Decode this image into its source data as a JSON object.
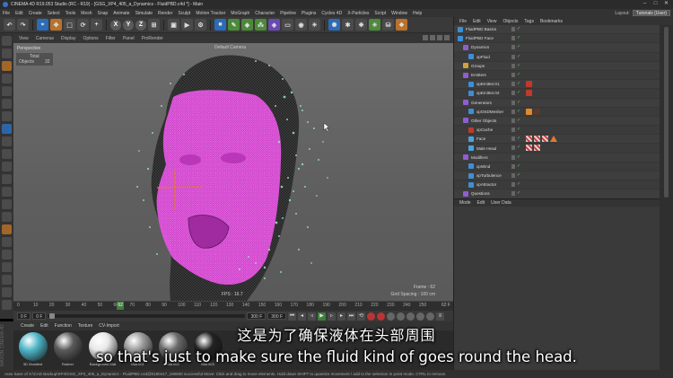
{
  "window": {
    "title": "CINEMA 4D R19.053 Studio (RC - R19) - [GSG_XP4_405_a_Dynamics - FluidPBD.c4d *] - Main"
  },
  "menu": [
    "File",
    "Edit",
    "Create",
    "Select",
    "Tools",
    "Mesh",
    "Snap",
    "Animate",
    "Simulate",
    "Render",
    "Sculpt",
    "Motion Tracker",
    "MoGraph",
    "Character",
    "Pipeline",
    "Plugins",
    "Cycles 4D",
    "X-Particles",
    "Script",
    "Window",
    "Help"
  ],
  "layout": {
    "label": "Layout:",
    "value": "Tutorials (User)"
  },
  "toolbar": {
    "x": "X",
    "y": "Y",
    "z": "Z"
  },
  "viewport": {
    "menu": [
      "View",
      "Cameras",
      "Display",
      "Options",
      "Filter",
      "Panel",
      "ProRender"
    ],
    "view_name": "Perspective",
    "stats_label": "Total",
    "stats_objects_label": "Objects",
    "stats_objects_value": "32",
    "camera": "Default Camera",
    "frame": "Frame : 62",
    "grid_spacing": "Grid Spacing : 100 cm",
    "fps": "FPS : 16.7"
  },
  "timeline": {
    "ticks": [
      "0",
      "10",
      "20",
      "30",
      "40",
      "50",
      "60",
      "70",
      "80",
      "90",
      "100",
      "110",
      "120",
      "130",
      "140",
      "150",
      "160",
      "170",
      "180",
      "190",
      "200",
      "210",
      "220",
      "230",
      "240",
      "250"
    ],
    "current": "62",
    "end": "62 F"
  },
  "transport": {
    "start": "0 F",
    "start2": "0 F",
    "end": "300 F",
    "end2": "300 F"
  },
  "materials": {
    "menu": [
      "Create",
      "Edit",
      "Function",
      "Texture",
      "CV-Import"
    ],
    "items": [
      {
        "name": "3D Gradient",
        "color": "#4fb7c9"
      },
      {
        "name": "Rubber",
        "color": "#5a5a5a"
      },
      {
        "name": "Background Mat",
        "color": "#e8e8e8"
      },
      {
        "name": "Mat.001",
        "color": "#9a9a9a"
      },
      {
        "name": "Mat.002",
        "color": "#6a6a6a"
      },
      {
        "name": "Mat.003",
        "color": "#222222"
      }
    ]
  },
  "side_label": "MAXON CINEMA 4D",
  "status": "Auto Save of X:\\CAD Backup\\XP4\\GSG_XP4_405_a_Dynamics - FluidPBD.c4d@0180417_190600 successful   Move: Click and drag to move elements. Hold down SHIFT to quantize movement / add to the selection in point mode, CTRL to remove.",
  "object_manager": {
    "menu": [
      "File",
      "Edit",
      "View",
      "Objects",
      "Tags",
      "Bookmarks"
    ],
    "objects": [
      {
        "name": "FluidPBD Basics",
        "indent": 0,
        "icon": "#3c8fd6",
        "tags": []
      },
      {
        "name": "FluidPBD Face",
        "indent": 0,
        "icon": "#3c8fd6",
        "tags": []
      },
      {
        "name": "Dynamics",
        "indent": 1,
        "icon": "#8d5fd0",
        "tags": []
      },
      {
        "name": "xpFluid",
        "indent": 2,
        "icon": "#3c8fd6",
        "tags": []
      },
      {
        "name": "Groups",
        "indent": 1,
        "icon": "#d0a23c",
        "tags": []
      },
      {
        "name": "Emitters",
        "indent": 1,
        "icon": "#8d5fd0",
        "tags": []
      },
      {
        "name": "xpEmitter.01",
        "indent": 2,
        "icon": "#3c8fd6",
        "tags": [
          "red"
        ]
      },
      {
        "name": "xpEmitter.02",
        "indent": 2,
        "icon": "#3c8fd6",
        "tags": [
          "red"
        ]
      },
      {
        "name": "Generators",
        "indent": 1,
        "icon": "#8d5fd0",
        "tags": []
      },
      {
        "name": "xpOSDMesher",
        "indent": 2,
        "icon": "#3c8fd6",
        "tags": [
          "ora",
          "dark"
        ]
      },
      {
        "name": "Other Objects",
        "indent": 1,
        "icon": "#8d5fd0",
        "tags": []
      },
      {
        "name": "xpCache",
        "indent": 2,
        "icon": "#c0392b",
        "tags": []
      },
      {
        "name": "Face",
        "indent": 2,
        "icon": "#4aa3df",
        "tags": [
          "chess",
          "chess",
          "chess",
          "tri"
        ]
      },
      {
        "name": "Male Head",
        "indent": 2,
        "icon": "#4aa3df",
        "tags": [
          "chess",
          "chess"
        ]
      },
      {
        "name": "Modifiers",
        "indent": 1,
        "icon": "#8d5fd0",
        "tags": []
      },
      {
        "name": "xpWind",
        "indent": 2,
        "icon": "#3c8fd6",
        "tags": []
      },
      {
        "name": "xpTurbulence",
        "indent": 2,
        "icon": "#3c8fd6",
        "tags": []
      },
      {
        "name": "xpAttractor",
        "indent": 2,
        "icon": "#3c8fd6",
        "tags": []
      },
      {
        "name": "Questions",
        "indent": 1,
        "icon": "#8d5fd0",
        "tags": []
      }
    ]
  },
  "attributes": {
    "menu": [
      "Mode",
      "Edit",
      "User Data"
    ]
  },
  "subtitle": {
    "cn": "这是为了确保液体在头部周围",
    "en": "so that's just to make sure the fluid kind of goes round the head."
  }
}
